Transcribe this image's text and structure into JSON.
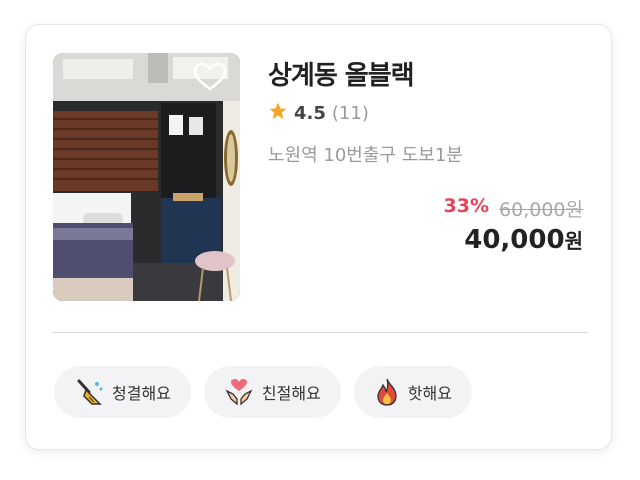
{
  "listing": {
    "title": "상계동 올블랙",
    "rating": "4.5",
    "review_count": "(11)",
    "location": "노원역 10번출구 도보1분",
    "discount": "33%",
    "original_price": "60,000원",
    "final_price": "40,000",
    "final_unit": "원",
    "favorite_icon": "heart-outline-icon",
    "rating_icon": "star-icon"
  },
  "tags": [
    {
      "label": "청결해요",
      "icon": "broom-icon"
    },
    {
      "label": "친절해요",
      "icon": "hands-heart-icon"
    },
    {
      "label": "핫해요",
      "icon": "fire-icon"
    }
  ],
  "colors": {
    "discount": "#e8425a",
    "star": "#f5a623",
    "chip_bg": "#f3f3f5"
  }
}
